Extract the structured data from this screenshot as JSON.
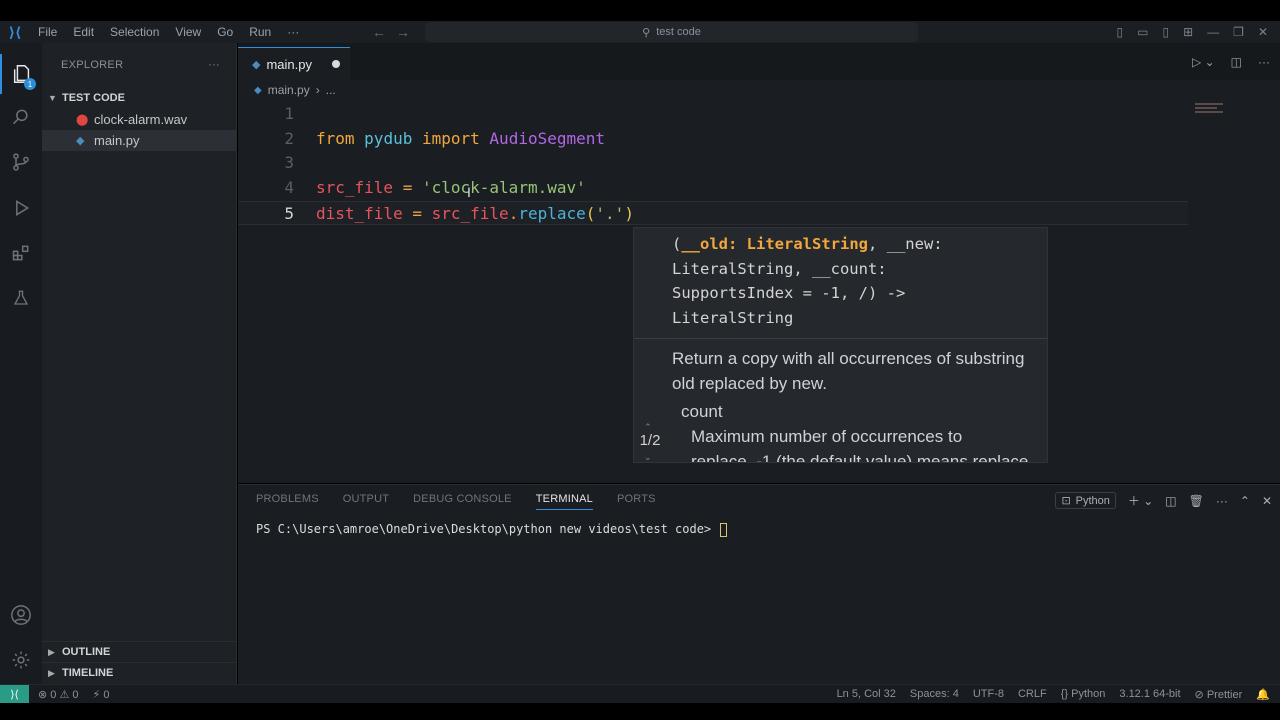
{
  "titlebar": {
    "menu": [
      "File",
      "Edit",
      "Selection",
      "View",
      "Go",
      "Run",
      "···"
    ],
    "search_text": "test code"
  },
  "activitybar": {
    "explorer_badge": "1"
  },
  "sidebar": {
    "header": "EXPLORER",
    "more": "···",
    "folder": "TEST CODE",
    "files": [
      {
        "name": "clock-alarm.wav",
        "type": "wav"
      },
      {
        "name": "main.py",
        "type": "py"
      }
    ],
    "outline": "OUTLINE",
    "timeline": "TIMELINE"
  },
  "editor": {
    "tab_label": "main.py",
    "breadcrumb_file": "main.py",
    "breadcrumb_more": "...",
    "line_numbers": [
      "1",
      "2",
      "3",
      "4",
      "5"
    ]
  },
  "sighelp": {
    "signature_parts": {
      "open": "(",
      "active_param": "__old: LiteralString",
      "rest_line1": ", __new:",
      "line2": "LiteralString, __count:",
      "line3": "SupportsIndex = -1, /) ->",
      "line4": "LiteralString"
    },
    "doc": "Return a copy with all occurrences of substring old replaced by new.",
    "param_name": "count",
    "param_doc_1": "Maximum number of occurrences to",
    "param_doc_2": "replace. -1 (the default value) means replace",
    "counter": "1/2"
  },
  "panel": {
    "tabs": [
      "PROBLEMS",
      "OUTPUT",
      "DEBUG CONSOLE",
      "TERMINAL",
      "PORTS"
    ],
    "active_tab": "TERMINAL",
    "profile": "Python",
    "prompt": "PS C:\\Users\\amroe\\OneDrive\\Desktop\\python new videos\\test code> "
  },
  "statusbar": {
    "errors": "0",
    "warnings": "0",
    "ports": "0",
    "position": "Ln 5, Col 32",
    "spaces": "Spaces: 4",
    "encoding": "UTF-8",
    "eol": "CRLF",
    "language": "Python",
    "interpreter": "3.12.1 64-bit",
    "formatter": "Prettier"
  }
}
